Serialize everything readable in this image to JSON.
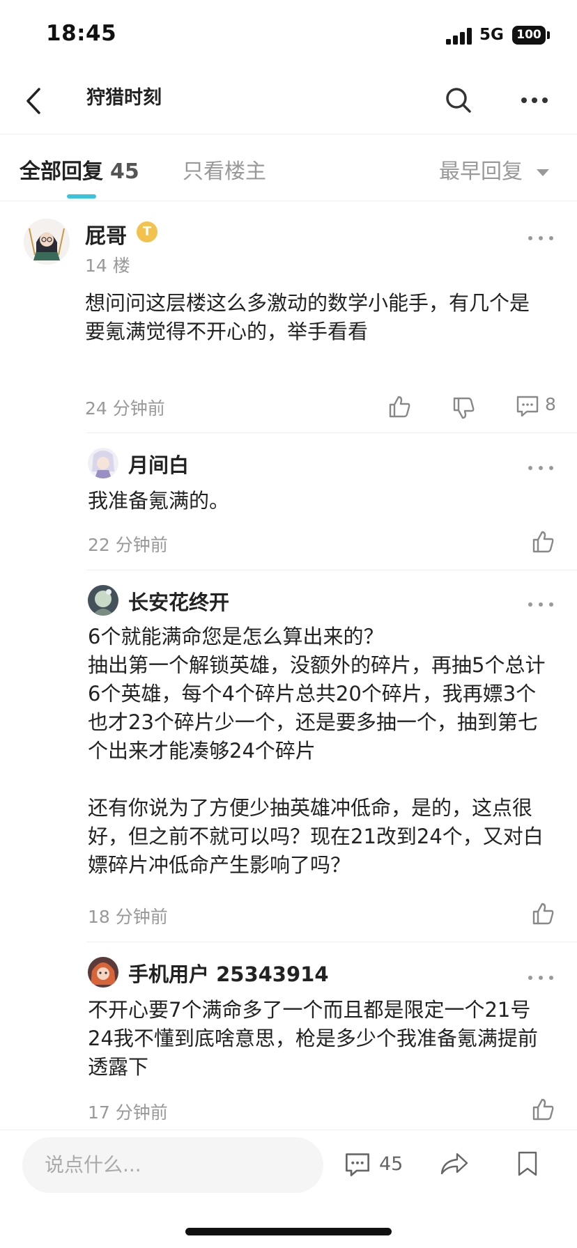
{
  "status_bar": {
    "time": "18:45",
    "network": "5G",
    "battery": "100"
  },
  "nav": {
    "title": "狩猎时刻"
  },
  "tabs": {
    "all_label": "全部回复",
    "all_count": "45",
    "owner_only": "只看楼主",
    "sort": "最早回复"
  },
  "post": {
    "author": "屁哥",
    "badge": "T",
    "floor": "14 楼",
    "content": "想问问这层楼这么多激动的数学小能手，有几个是要氪满觉得不开心的，举手看看",
    "time": "24 分钟前",
    "comment_count": "8"
  },
  "replies": [
    {
      "author": "月间白",
      "content": "我准备氪满的。",
      "time": "22 分钟前"
    },
    {
      "author": "长安花终开",
      "content": "6个就能满命您是怎么算出来的？\n抽出第一个解锁英雄，没额外的碎片，再抽5个总计6个英雄，每个4个碎片总共20个碎片，我再嫖3个也才23个碎片少一个，还是要多抽一个，抽到第七个出来才能凑够24个碎片\n\n还有你说为了方便少抽英雄冲低命，是的，这点很好，但之前不就可以吗？现在21改到24个，又对白嫖碎片冲低命产生影响了吗？",
      "time": "18 分钟前"
    },
    {
      "author": "手机用户 25343914",
      "content": "不开心要7个满命多了一个而且都是限定一个21号24我不懂到底啥意思，枪是多少个我准备氪满提前透露下",
      "time": "17 分钟前"
    }
  ],
  "bottom_bar": {
    "placeholder": "说点什么...",
    "comment_count": "45"
  },
  "colors": {
    "accent": "#37c4dc",
    "text": "#222222",
    "muted": "#999999",
    "divider": "#eeeeee"
  }
}
